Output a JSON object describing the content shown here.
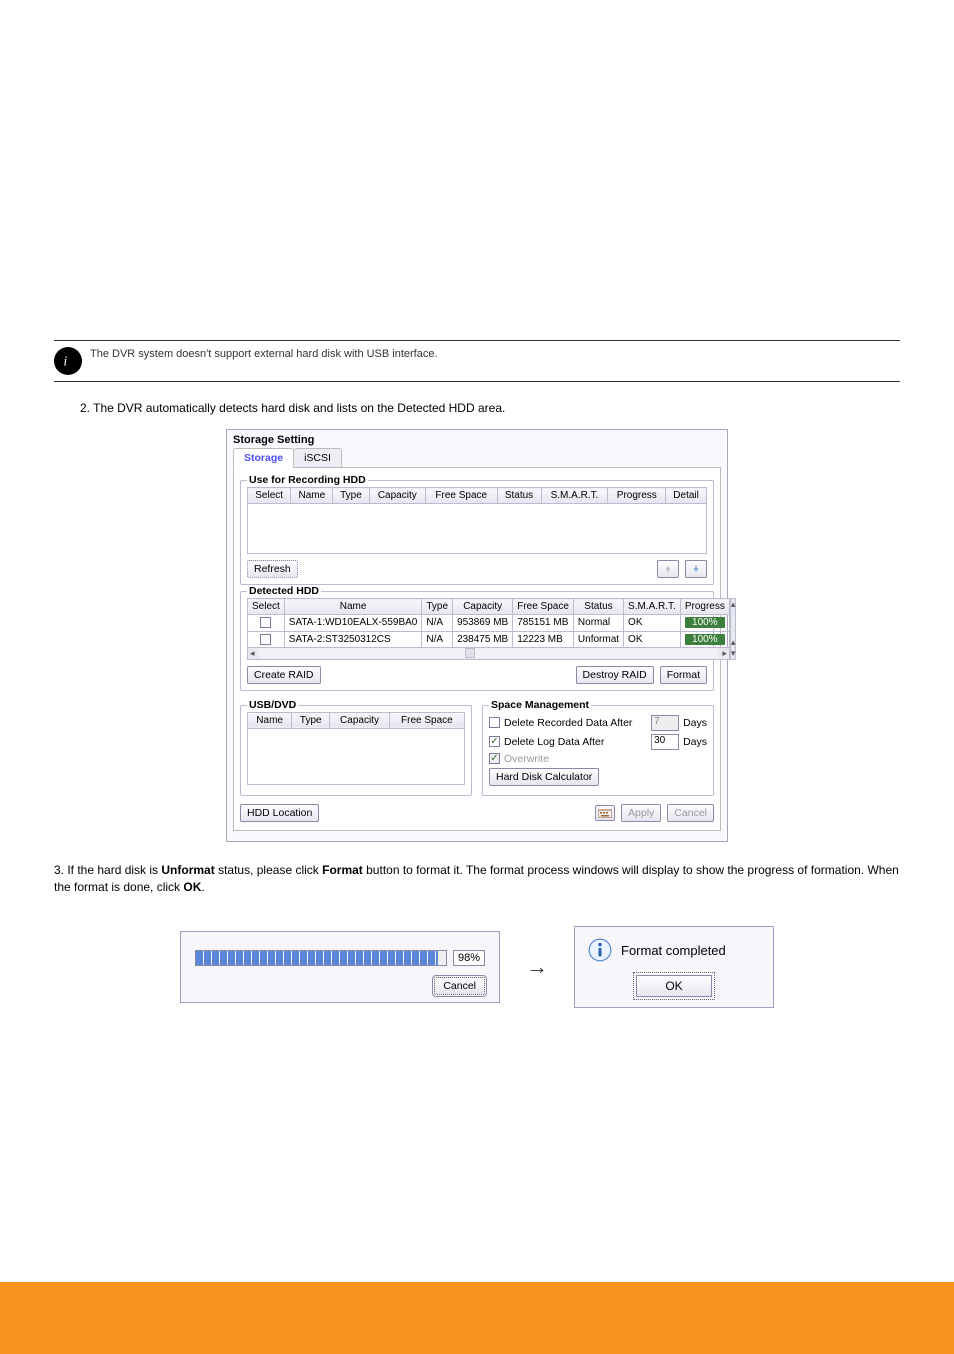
{
  "domain": "Document",
  "info_note": "The DVR system doesn't support external hard disk with USB interface.",
  "step2": "2. The DVR automatically detects hard disk and lists on the Detected HDD area.",
  "step3_lead": "3. If the hard disk is ",
  "step3_bold": "Unformat",
  "step3_mid": " status, please click ",
  "step3_btn": "Format",
  "step3_tail": " button to format it. The format process windows will display to show the progress of formation. When the format is done, click ",
  "step3_ok": "OK",
  "step3_end": ".",
  "storage": {
    "window_title": "Storage Setting",
    "tabs": {
      "storage": "Storage",
      "iscsi": "iSCSI"
    },
    "rec_group": "Use for Recording HDD",
    "rec_cols": [
      "Select",
      "Name",
      "Type",
      "Capacity",
      "Free Space",
      "Status",
      "S.M.A.R.T.",
      "Progress",
      "Detail"
    ],
    "refresh": "Refresh",
    "det_group": "Detected HDD",
    "det_cols": [
      "Select",
      "Name",
      "Type",
      "Capacity",
      "Free Space",
      "Status",
      "S.M.A.R.T.",
      "Progress"
    ],
    "det_rows": [
      {
        "name": "SATA-1:WD10EALX-559BA0",
        "type": "N/A",
        "capacity": "953869 MB",
        "free": "785151 MB",
        "status": "Normal",
        "smart": "OK",
        "progress": "100%"
      },
      {
        "name": "SATA-2:ST3250312CS",
        "type": "N/A",
        "capacity": "238475 MB",
        "free": "12223 MB",
        "status": "Unformat",
        "smart": "OK",
        "progress": "100%"
      }
    ],
    "create_raid": "Create RAID",
    "destroy_raid": "Destroy RAID",
    "format": "Format",
    "usb_group": "USB/DVD",
    "usb_cols": [
      "Name",
      "Type",
      "Capacity",
      "Free Space"
    ],
    "space_group": "Space Management",
    "del_rec": "Delete Recorded Data After",
    "del_log": "Delete Log Data After",
    "days": "Days",
    "rec_days_value": "7",
    "log_days_value": "30",
    "overwrite": "Overwrite",
    "hdd_calc": "Hard Disk Calculator",
    "hdd_loc": "HDD Location",
    "apply": "Apply",
    "cancel": "Cancel"
  },
  "progress_dialog": {
    "percent": "98%",
    "cancel": "Cancel"
  },
  "done_dialog": {
    "msg": "Format completed",
    "ok": "OK"
  }
}
